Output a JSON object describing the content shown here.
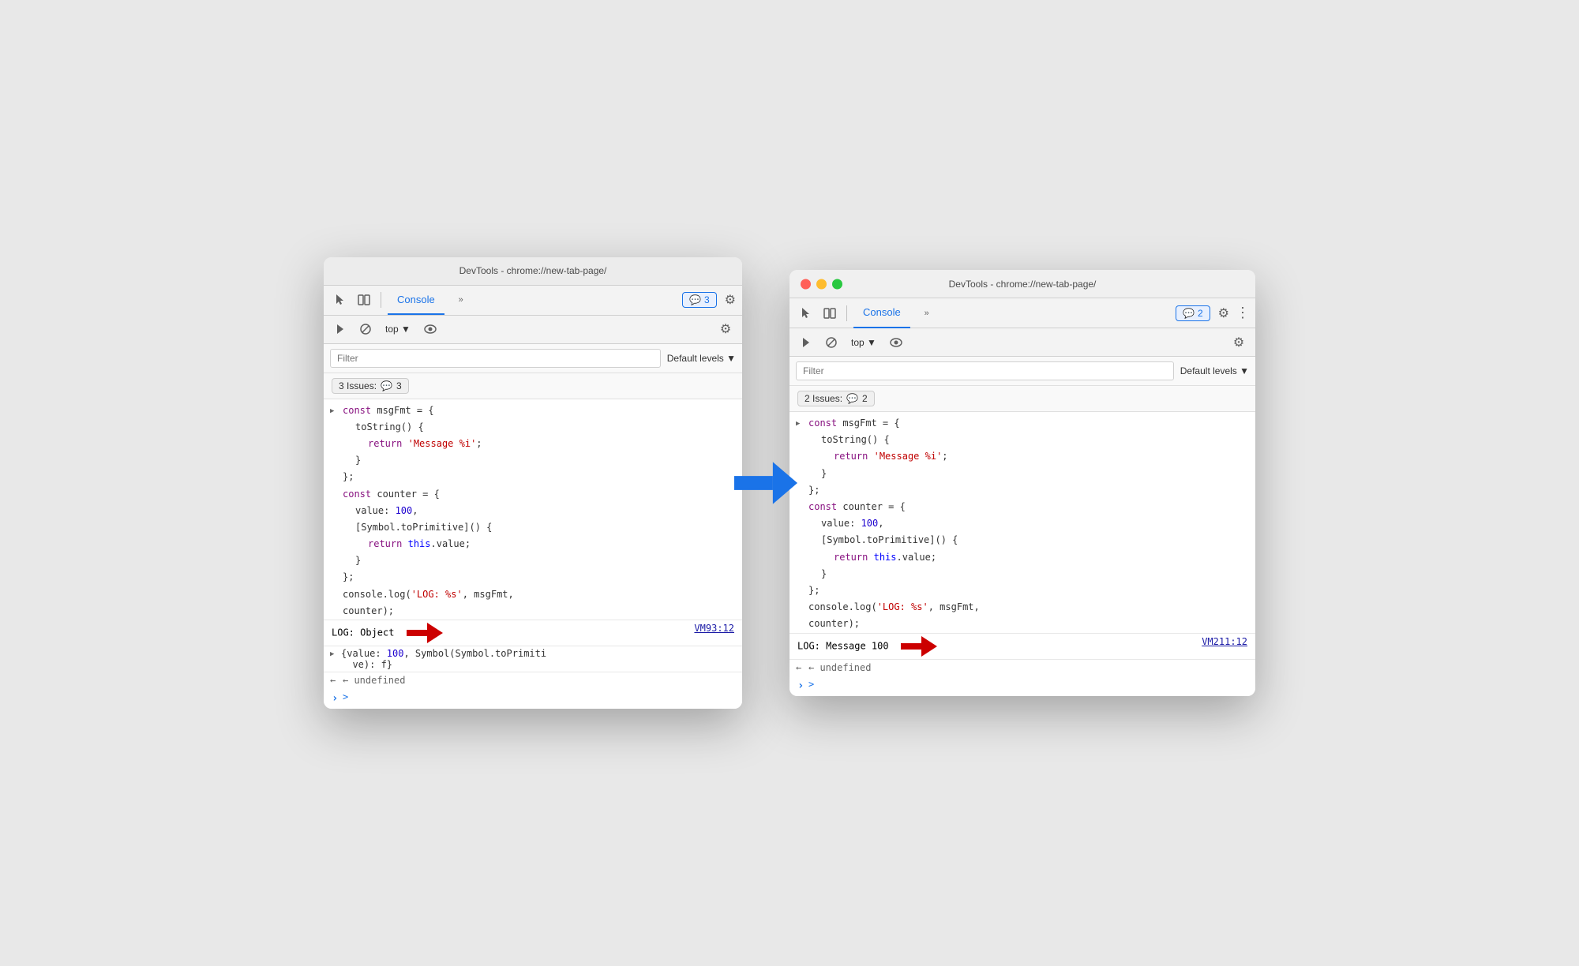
{
  "left_window": {
    "title": "DevTools - chrome://new-tab-page/",
    "tab_label": "Console",
    "chevron_label": "»",
    "badge_count": "3",
    "top_dropdown": "top ▼",
    "filter_placeholder": "Filter",
    "default_levels": "Default levels ▼",
    "issues_label": "3 Issues:",
    "issues_count": "3",
    "vm_link": "VM93:12",
    "code_lines": [
      "> const msgFmt = {",
      "    toString() {",
      "      return 'Message %i';",
      "    }",
      "};",
      "const counter = {",
      "    value: 100,",
      "    [Symbol.toPrimitive]() {",
      "      return this.value;",
      "    }",
      "};",
      "console.log('LOG: %s', msgFmt,",
      "counter);"
    ],
    "log_output": "LOG: Object",
    "obj_detail": "{value: 100, Symbol(Symbol.toPrimitive): f}",
    "undefined_text": "← undefined",
    "prompt": ">"
  },
  "right_window": {
    "title": "DevTools - chrome://new-tab-page/",
    "tab_label": "Console",
    "chevron_label": "»",
    "badge_count": "2",
    "top_dropdown": "top ▼",
    "filter_placeholder": "Filter",
    "default_levels": "Default levels ▼",
    "issues_label": "2 Issues:",
    "issues_count": "2",
    "vm_link": "VM211:12",
    "code_lines": [
      "> const msgFmt = {",
      "    toString() {",
      "      return 'Message %i';",
      "    }",
      "};",
      "const counter = {",
      "    value: 100,",
      "    [Symbol.toPrimitive]() {",
      "      return this.value;",
      "    }",
      "};",
      "console.log('LOG: %s', msgFmt,",
      "counter);"
    ],
    "log_output": "LOG: Message 100",
    "undefined_text": "← undefined",
    "prompt": ">"
  },
  "arrow": {
    "color": "#1a73e8",
    "direction": "right"
  }
}
